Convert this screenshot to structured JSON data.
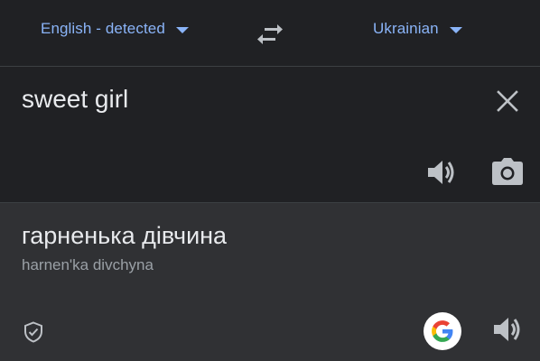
{
  "languages": {
    "source": "English - detected",
    "target": "Ukrainian"
  },
  "input": {
    "text": "sweet girl"
  },
  "output": {
    "translation": "гарненька дівчина",
    "transliteration": "harnenʹka divchyna"
  },
  "icons": {
    "swap": "swap-arrows-icon",
    "clear": "close-icon",
    "listen_source": "speaker-icon",
    "camera": "camera-icon",
    "verified": "shield-check-icon",
    "google": "google-g-logo",
    "listen_target": "speaker-icon"
  },
  "colors": {
    "background": "#202124",
    "output_background": "#303134",
    "accent": "#8ab4f8",
    "text_primary": "#e8eaed",
    "text_secondary": "#9aa0a6",
    "icon": "#bdc1c6"
  }
}
